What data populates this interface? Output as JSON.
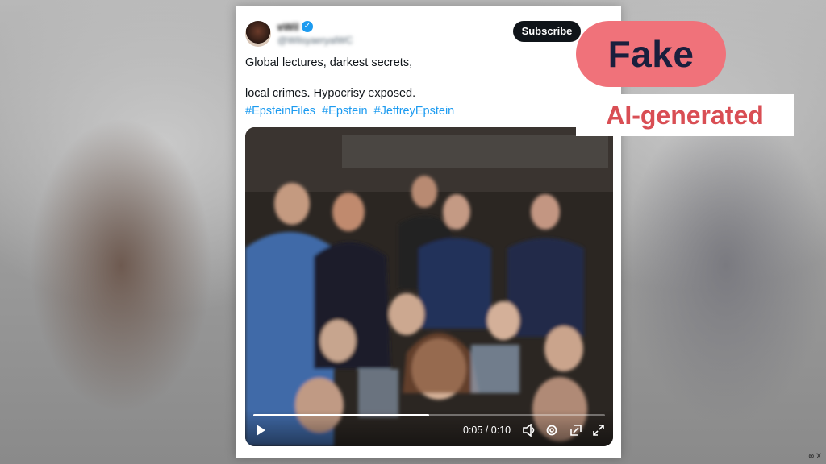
{
  "post": {
    "author_name": "ɐWil",
    "author_handle": "@WilsyaeryalWC",
    "subscribe_label": "Subscribe",
    "text_line1": "Global lectures, darkest secrets,",
    "text_line2": "local crimes. Hypocrisy exposed.",
    "hashtags": [
      "#EpsteinFiles",
      "#Epstein",
      "#JeffreyEpstein"
    ]
  },
  "video": {
    "time": "0:05 / 0:10",
    "progress": 0.5,
    "icons": [
      "play-icon",
      "volume-icon",
      "settings-icon",
      "pip-icon",
      "fullscreen-icon"
    ]
  },
  "labels": {
    "fake": "Fake",
    "ai_generated": "AI-generated"
  },
  "credit": "⊗ X",
  "colors": {
    "fake_bg": "#f0727a",
    "fake_text": "#1a1f3d",
    "ai_text": "#d94e54",
    "link": "#1d9bf0",
    "button": "#0f1419"
  }
}
